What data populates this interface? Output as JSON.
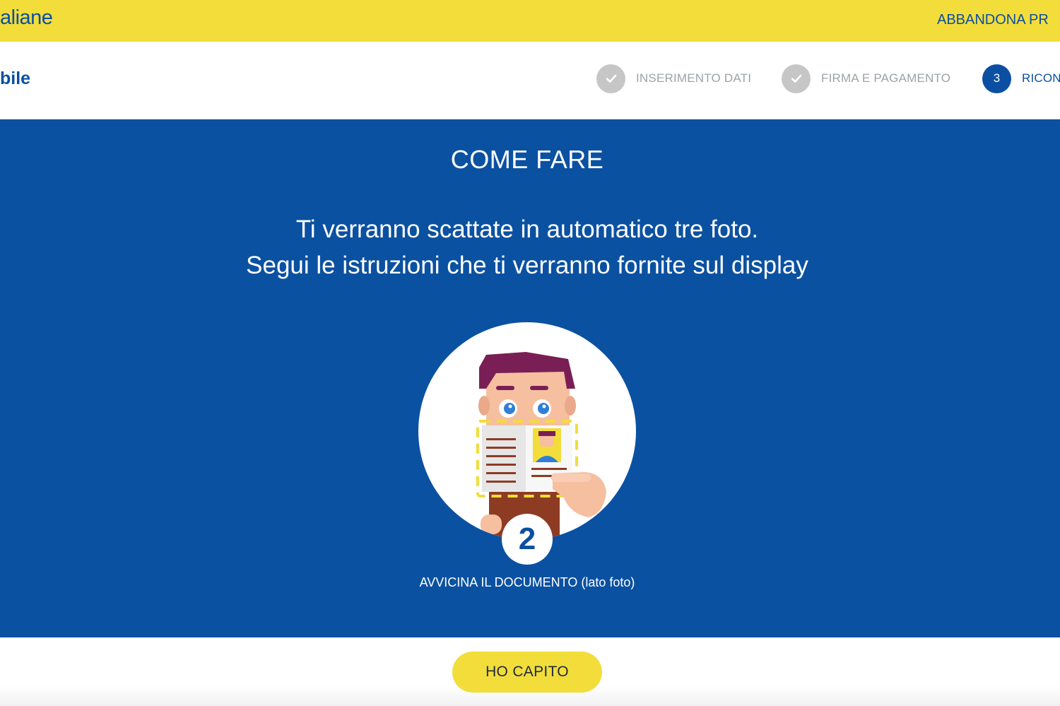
{
  "header": {
    "brand_text": "aliane",
    "exit_link": "ABBANDONA PR"
  },
  "subheader": {
    "product": "bile",
    "steps": [
      {
        "label": "INSERIMENTO DATI",
        "state": "done",
        "icon": "check-icon"
      },
      {
        "label": "FIRMA E PAGAMENTO",
        "state": "done",
        "icon": "check-icon"
      },
      {
        "number": "3",
        "label": "RICON",
        "state": "active"
      }
    ]
  },
  "panel": {
    "title": "COME FARE",
    "instruction_line1": "Ti verranno scattate in automatico tre foto.",
    "instruction_line2": "Segui le istruzioni che ti verranno fornite sul display",
    "illustration": {
      "icon": "person-holding-id-document-illustration",
      "step_number": "2"
    },
    "caption": "AVVICINA IL DOCUMENTO (lato foto)"
  },
  "footer": {
    "cta_label": "HO CAPITO"
  },
  "colors": {
    "brand_yellow": "#f2dd3b",
    "brand_blue": "#0b4fa2",
    "panel_blue": "#0b51a1",
    "done_grey": "#c6c6c6"
  }
}
